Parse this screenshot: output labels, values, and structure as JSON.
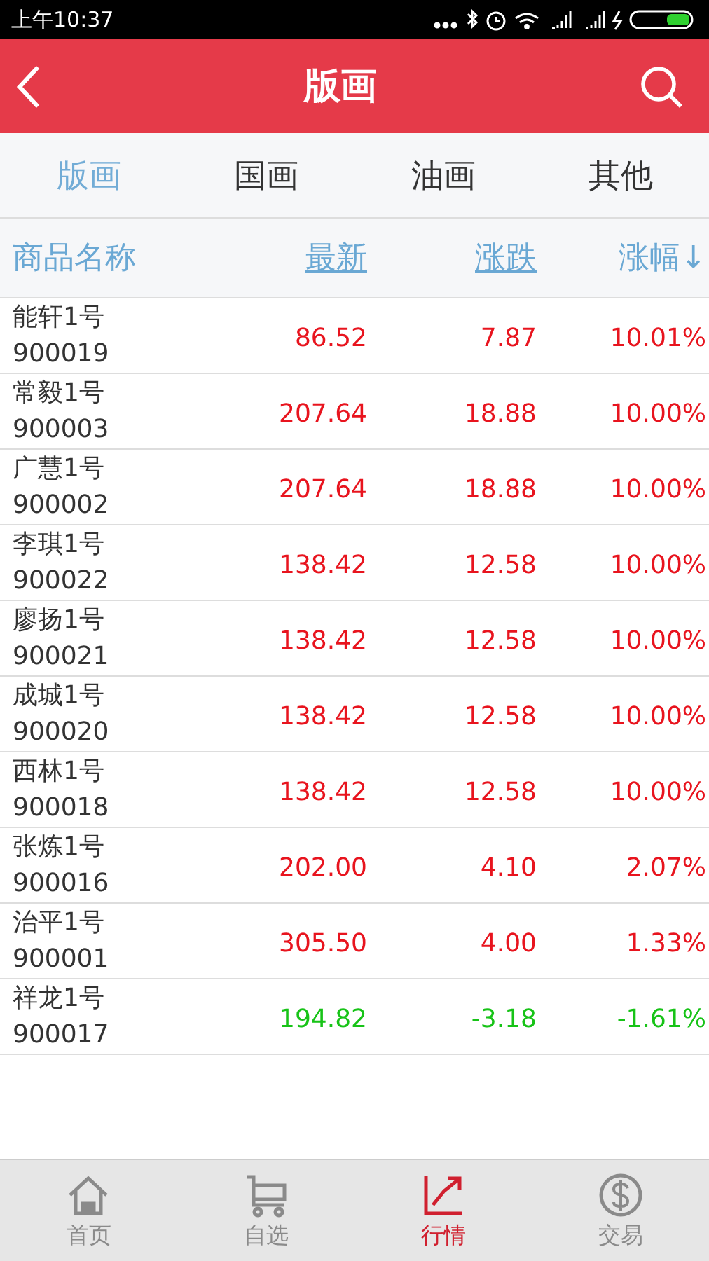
{
  "status_bar": {
    "time": "上午10:37"
  },
  "header": {
    "title": "版画"
  },
  "tabs": [
    {
      "label": "版画",
      "selected": true
    },
    {
      "label": "国画",
      "selected": false
    },
    {
      "label": "油画",
      "selected": false
    },
    {
      "label": "其他",
      "selected": false
    }
  ],
  "table": {
    "columns": [
      {
        "label": "商品名称",
        "underlined": false
      },
      {
        "label": "最新",
        "underlined": true
      },
      {
        "label": "涨跌",
        "underlined": true
      },
      {
        "label": "涨幅↓",
        "underlined": false
      }
    ],
    "rows": [
      {
        "name": "能轩1号",
        "code": "900019",
        "price": "86.52",
        "change": "7.87",
        "percent": "10.01%",
        "color": "#e8141e"
      },
      {
        "name": "常毅1号",
        "code": "900003",
        "price": "207.64",
        "change": "18.88",
        "percent": "10.00%",
        "color": "#e8141e"
      },
      {
        "name": "广慧1号",
        "code": "900002",
        "price": "207.64",
        "change": "18.88",
        "percent": "10.00%",
        "color": "#e8141e"
      },
      {
        "name": "李琪1号",
        "code": "900022",
        "price": "138.42",
        "change": "12.58",
        "percent": "10.00%",
        "color": "#e8141e"
      },
      {
        "name": "廖扬1号",
        "code": "900021",
        "price": "138.42",
        "change": "12.58",
        "percent": "10.00%",
        "color": "#e8141e"
      },
      {
        "name": "成城1号",
        "code": "900020",
        "price": "138.42",
        "change": "12.58",
        "percent": "10.00%",
        "color": "#e8141e"
      },
      {
        "name": "西林1号",
        "code": "900018",
        "price": "138.42",
        "change": "12.58",
        "percent": "10.00%",
        "color": "#e8141e"
      },
      {
        "name": "张炼1号",
        "code": "900016",
        "price": "202.00",
        "change": "4.10",
        "percent": "2.07%",
        "color": "#e8141e"
      },
      {
        "name": "治平1号",
        "code": "900001",
        "price": "305.50",
        "change": "4.00",
        "percent": "1.33%",
        "color": "#e8141e"
      },
      {
        "name": "祥龙1号",
        "code": "900017",
        "price": "194.82",
        "change": "-3.18",
        "percent": "-1.61%",
        "color": "#17c317"
      }
    ]
  },
  "bottom_nav": [
    {
      "label": "首页",
      "kind": "home",
      "selected": false
    },
    {
      "label": "自选",
      "kind": "cart",
      "selected": false
    },
    {
      "label": "行情",
      "kind": "chart",
      "selected": true
    },
    {
      "label": "交易",
      "kind": "dollar",
      "selected": false
    }
  ]
}
